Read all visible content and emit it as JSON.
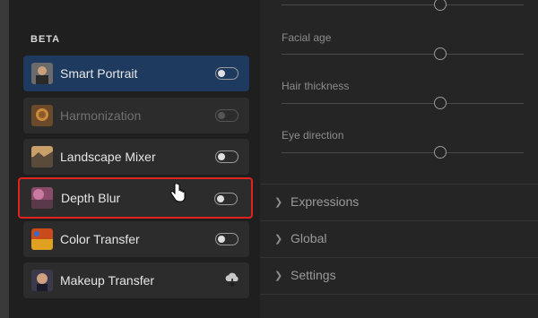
{
  "section": {
    "label": "BETA"
  },
  "filters": [
    {
      "name": "Smart Portrait",
      "state": "active",
      "toggle": "off"
    },
    {
      "name": "Harmonization",
      "state": "disabled",
      "toggle": "off"
    },
    {
      "name": "Landscape Mixer",
      "state": "normal",
      "toggle": "off"
    },
    {
      "name": "Depth Blur",
      "state": "highlighted",
      "toggle": "off"
    },
    {
      "name": "Color Transfer",
      "state": "normal",
      "toggle": "off"
    },
    {
      "name": "Makeup Transfer",
      "state": "normal",
      "action": "cloud-download-icon"
    }
  ],
  "sliders": [
    {
      "label": "Facial age"
    },
    {
      "label": "Hair thickness"
    },
    {
      "label": "Eye direction"
    }
  ],
  "sections": [
    {
      "title": "Expressions"
    },
    {
      "title": "Global"
    },
    {
      "title": "Settings"
    }
  ],
  "colors": {
    "active_bg": "#1e3a5f",
    "highlight_border": "#e0231c",
    "panel_bg": "#252525"
  }
}
